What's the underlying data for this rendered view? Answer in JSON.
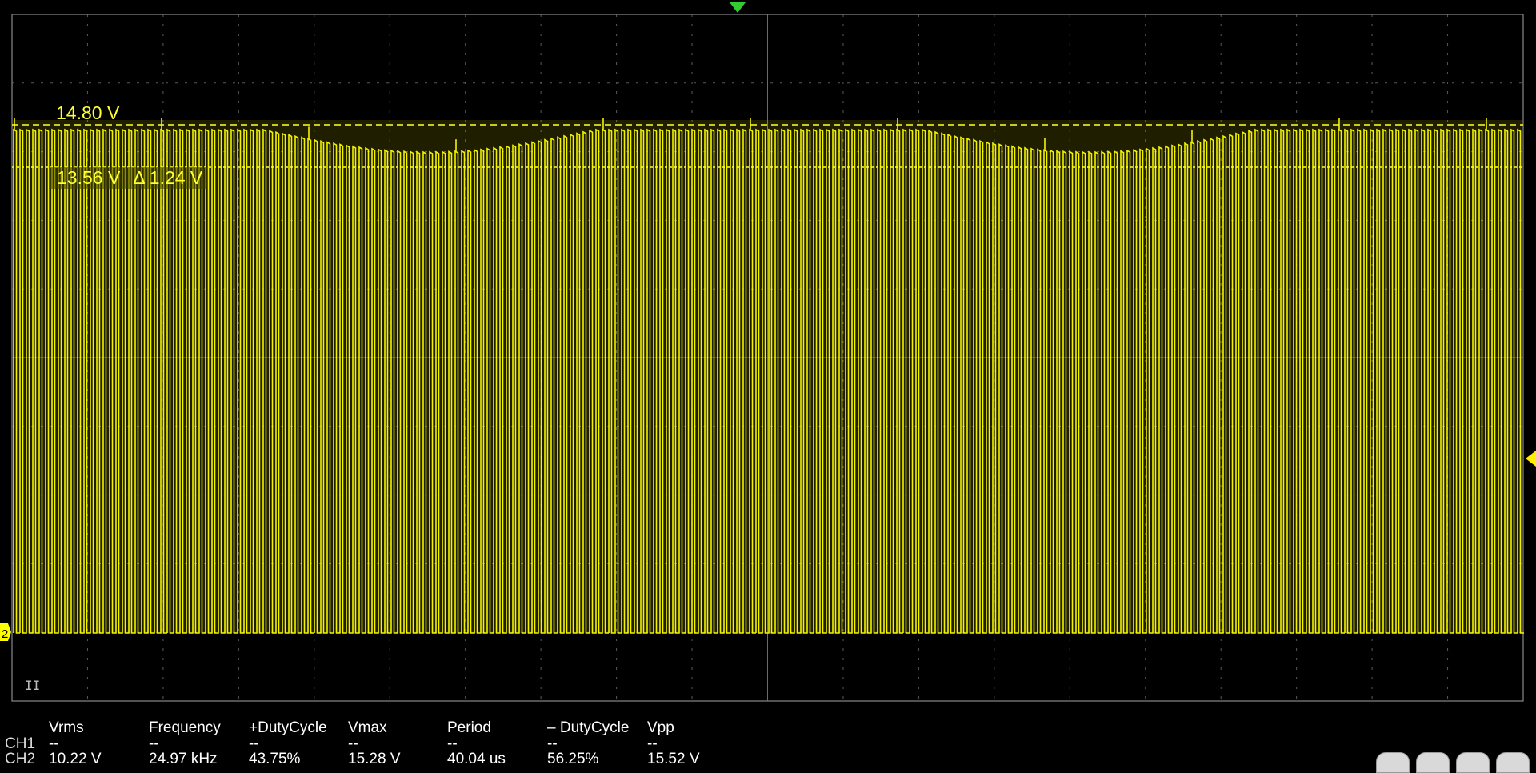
{
  "scope": {
    "waveform_color": "#ffff00",
    "grid_color": "#777777",
    "trigger_marker_color": "#33cc33",
    "trigger_level_color": "#ffee00",
    "channel_marker_label": "2"
  },
  "cursors": {
    "a_label": "14.80 V",
    "b_label": "13.56 V",
    "delta_label": "Δ 1.24 V"
  },
  "acquisition": {
    "run_state_symbol": "II"
  },
  "measurements": {
    "headers": [
      "Vrms",
      "Frequency",
      "+DutyCycle",
      "Vmax",
      "Period",
      "– DutyCycle",
      "Vpp"
    ],
    "rows": [
      {
        "label": "CH1",
        "values": [
          "--",
          "--",
          "--",
          "--",
          "--",
          "--",
          "--"
        ]
      },
      {
        "label": "CH2",
        "values": [
          "10.22 V",
          "24.97 kHz",
          "43.75%",
          "15.28 V",
          "40.04 us",
          "56.25%",
          "15.52 V"
        ]
      }
    ]
  },
  "toolbar": {
    "icons": [
      "zoom-icon",
      "save-icon",
      "export-icon",
      "home-icon"
    ]
  }
}
